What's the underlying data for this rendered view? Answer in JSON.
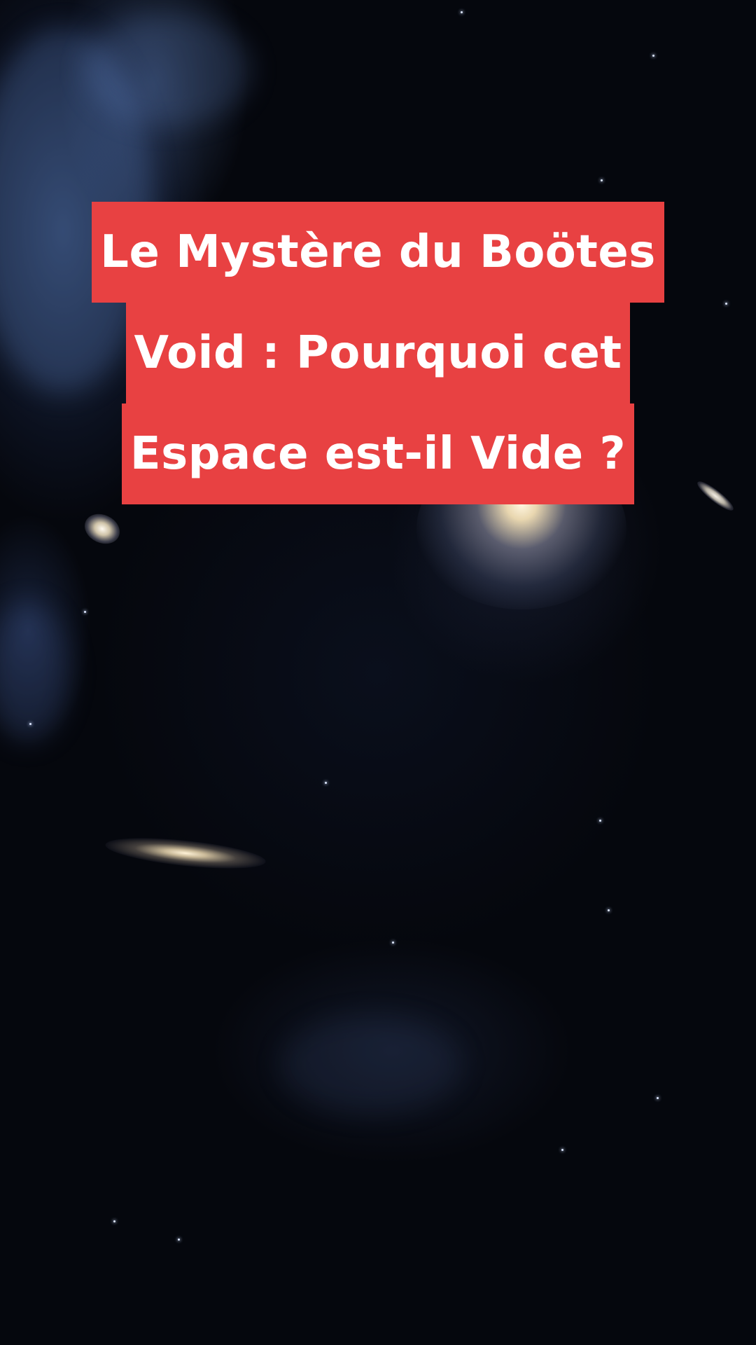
{
  "title": {
    "lines": [
      "Le Mystère du Boötes",
      "Void : Pourquoi cet",
      "Espace est-il Vide ?"
    ]
  },
  "colors": {
    "title_background": "#e84142",
    "title_text": "#ffffff",
    "space_background": "#05070d"
  }
}
